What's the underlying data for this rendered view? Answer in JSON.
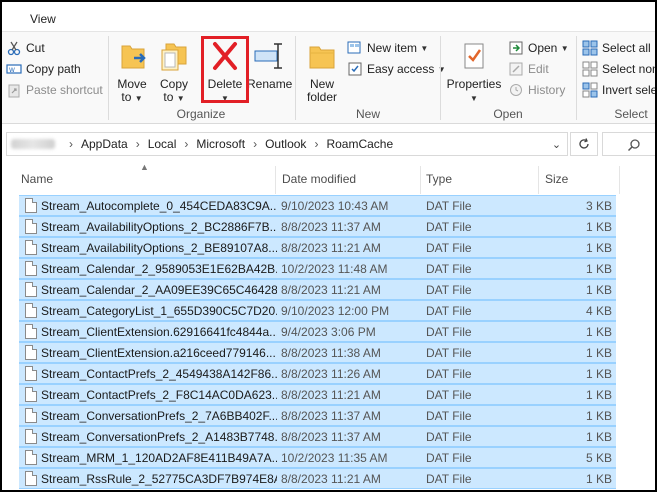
{
  "menu": {
    "view_tab": "View"
  },
  "ribbon": {
    "clipboard": {
      "cut": "Cut",
      "copy_path": "Copy path",
      "paste_shortcut": "Paste shortcut"
    },
    "organize": {
      "label": "Organize",
      "move_to": "Move",
      "move_to_2": "to",
      "copy_to": "Copy",
      "copy_to_2": "to",
      "delete": "Delete",
      "rename": "Rename"
    },
    "new": {
      "label": "New",
      "new_folder": "New",
      "new_folder_2": "folder",
      "new_item": "New item",
      "easy_access": "Easy access"
    },
    "open": {
      "label": "Open",
      "properties": "Properties",
      "open": "Open",
      "edit": "Edit",
      "history": "History"
    },
    "select": {
      "label": "Select",
      "select_all": "Select all",
      "select_none": "Select non",
      "invert_selection": "Invert selec"
    }
  },
  "address": {
    "crumbs": [
      "AppData",
      "Local",
      "Microsoft",
      "Outlook",
      "RoamCache"
    ]
  },
  "columns": {
    "name": "Name",
    "date": "Date modified",
    "type": "Type",
    "size": "Size"
  },
  "files": [
    {
      "name": "Stream_Autocomplete_0_454CEDA83C9A...",
      "date": "9/10/2023 10:43 AM",
      "type": "DAT File",
      "size": "3 KB"
    },
    {
      "name": "Stream_AvailabilityOptions_2_BC2886F7B...",
      "date": "8/8/2023 11:37 AM",
      "type": "DAT File",
      "size": "1 KB"
    },
    {
      "name": "Stream_AvailabilityOptions_2_BE89107A8...",
      "date": "8/8/2023 11:21 AM",
      "type": "DAT File",
      "size": "1 KB"
    },
    {
      "name": "Stream_Calendar_2_9589053E1E62BA42B...",
      "date": "10/2/2023 11:48 AM",
      "type": "DAT File",
      "size": "1 KB"
    },
    {
      "name": "Stream_Calendar_2_AA09EE39C65C46428...",
      "date": "8/8/2023 11:21 AM",
      "type": "DAT File",
      "size": "1 KB"
    },
    {
      "name": "Stream_CategoryList_1_655D390C5C7D20...",
      "date": "9/10/2023 12:00 PM",
      "type": "DAT File",
      "size": "4 KB"
    },
    {
      "name": "Stream_ClientExtension.62916641fc4844a...",
      "date": "9/4/2023 3:06 PM",
      "type": "DAT File",
      "size": "1 KB"
    },
    {
      "name": "Stream_ClientExtension.a216ceed779146...",
      "date": "8/8/2023 11:38 AM",
      "type": "DAT File",
      "size": "1 KB"
    },
    {
      "name": "Stream_ContactPrefs_2_4549438A142F86...",
      "date": "8/8/2023 11:26 AM",
      "type": "DAT File",
      "size": "1 KB"
    },
    {
      "name": "Stream_ContactPrefs_2_F8C14AC0DA623...",
      "date": "8/8/2023 11:21 AM",
      "type": "DAT File",
      "size": "1 KB"
    },
    {
      "name": "Stream_ConversationPrefs_2_7A6BB402F...",
      "date": "8/8/2023 11:37 AM",
      "type": "DAT File",
      "size": "1 KB"
    },
    {
      "name": "Stream_ConversationPrefs_2_A1483B7748...",
      "date": "8/8/2023 11:37 AM",
      "type": "DAT File",
      "size": "1 KB"
    },
    {
      "name": "Stream_MRM_1_120AD2AF8E411B49A7A...",
      "date": "10/2/2023 11:35 AM",
      "type": "DAT File",
      "size": "5 KB"
    },
    {
      "name": "Stream_RssRule_2_52775CA3DF7B974E8A...",
      "date": "8/8/2023 11:21 AM",
      "type": "DAT File",
      "size": "1 KB"
    }
  ],
  "colors": {
    "selection_bg": "#cce8ff",
    "selection_border": "#99d1ff",
    "highlight": "#e21f26"
  }
}
